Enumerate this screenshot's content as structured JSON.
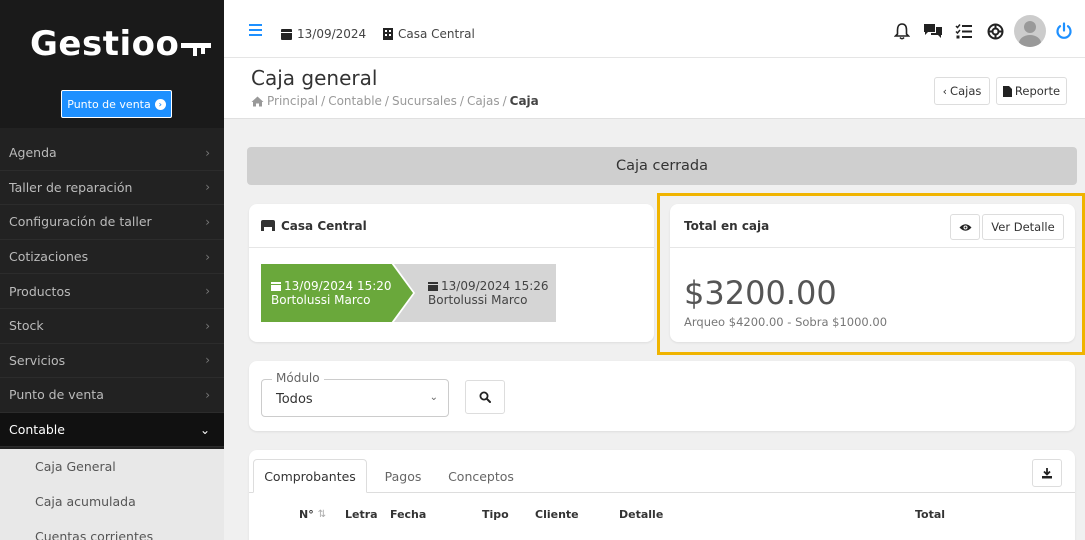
{
  "app": {
    "logo": "Gestioo"
  },
  "sidebar": {
    "pos_button": "Punto de venta",
    "items": [
      {
        "label": "Agenda"
      },
      {
        "label": "Taller de reparación"
      },
      {
        "label": "Configuración de taller"
      },
      {
        "label": "Cotizaciones"
      },
      {
        "label": "Productos"
      },
      {
        "label": "Stock"
      },
      {
        "label": "Servicios"
      },
      {
        "label": "Punto de venta"
      },
      {
        "label": "Contable"
      }
    ],
    "subitems": [
      {
        "label": "Caja General"
      },
      {
        "label": "Caja acumulada"
      },
      {
        "label": "Cuentas corrientes"
      }
    ]
  },
  "topbar": {
    "date": "13/09/2024",
    "branch": "Casa Central"
  },
  "header": {
    "title": "Caja general",
    "breadcrumb": [
      "Principal",
      "Contable",
      "Sucursales",
      "Cajas",
      "Caja"
    ],
    "btn_cajas": "Cajas",
    "btn_reporte": "Reporte"
  },
  "status": {
    "text": "Caja cerrada"
  },
  "branch_card": {
    "title": "Casa Central",
    "open": {
      "datetime": "13/09/2024 15:20",
      "user": "Bortolussi Marco"
    },
    "close": {
      "datetime": "13/09/2024 15:26",
      "user": "Bortolussi Marco"
    }
  },
  "total_card": {
    "title": "Total en caja",
    "detail_button": "Ver Detalle",
    "amount": "$3200.00",
    "sub": "Arqueo $4200.00 - Sobra $1000.00"
  },
  "filter": {
    "legend": "Módulo",
    "value": "Todos"
  },
  "tabs": [
    {
      "label": "Comprobantes"
    },
    {
      "label": "Pagos"
    },
    {
      "label": "Conceptos"
    }
  ],
  "columns": [
    "N°",
    "Letra",
    "Fecha",
    "Tipo",
    "Cliente",
    "Detalle",
    "Total"
  ],
  "colors": {
    "accent": "#1e90ff",
    "open_step": "#6aa83b",
    "highlight": "#f0b400"
  }
}
